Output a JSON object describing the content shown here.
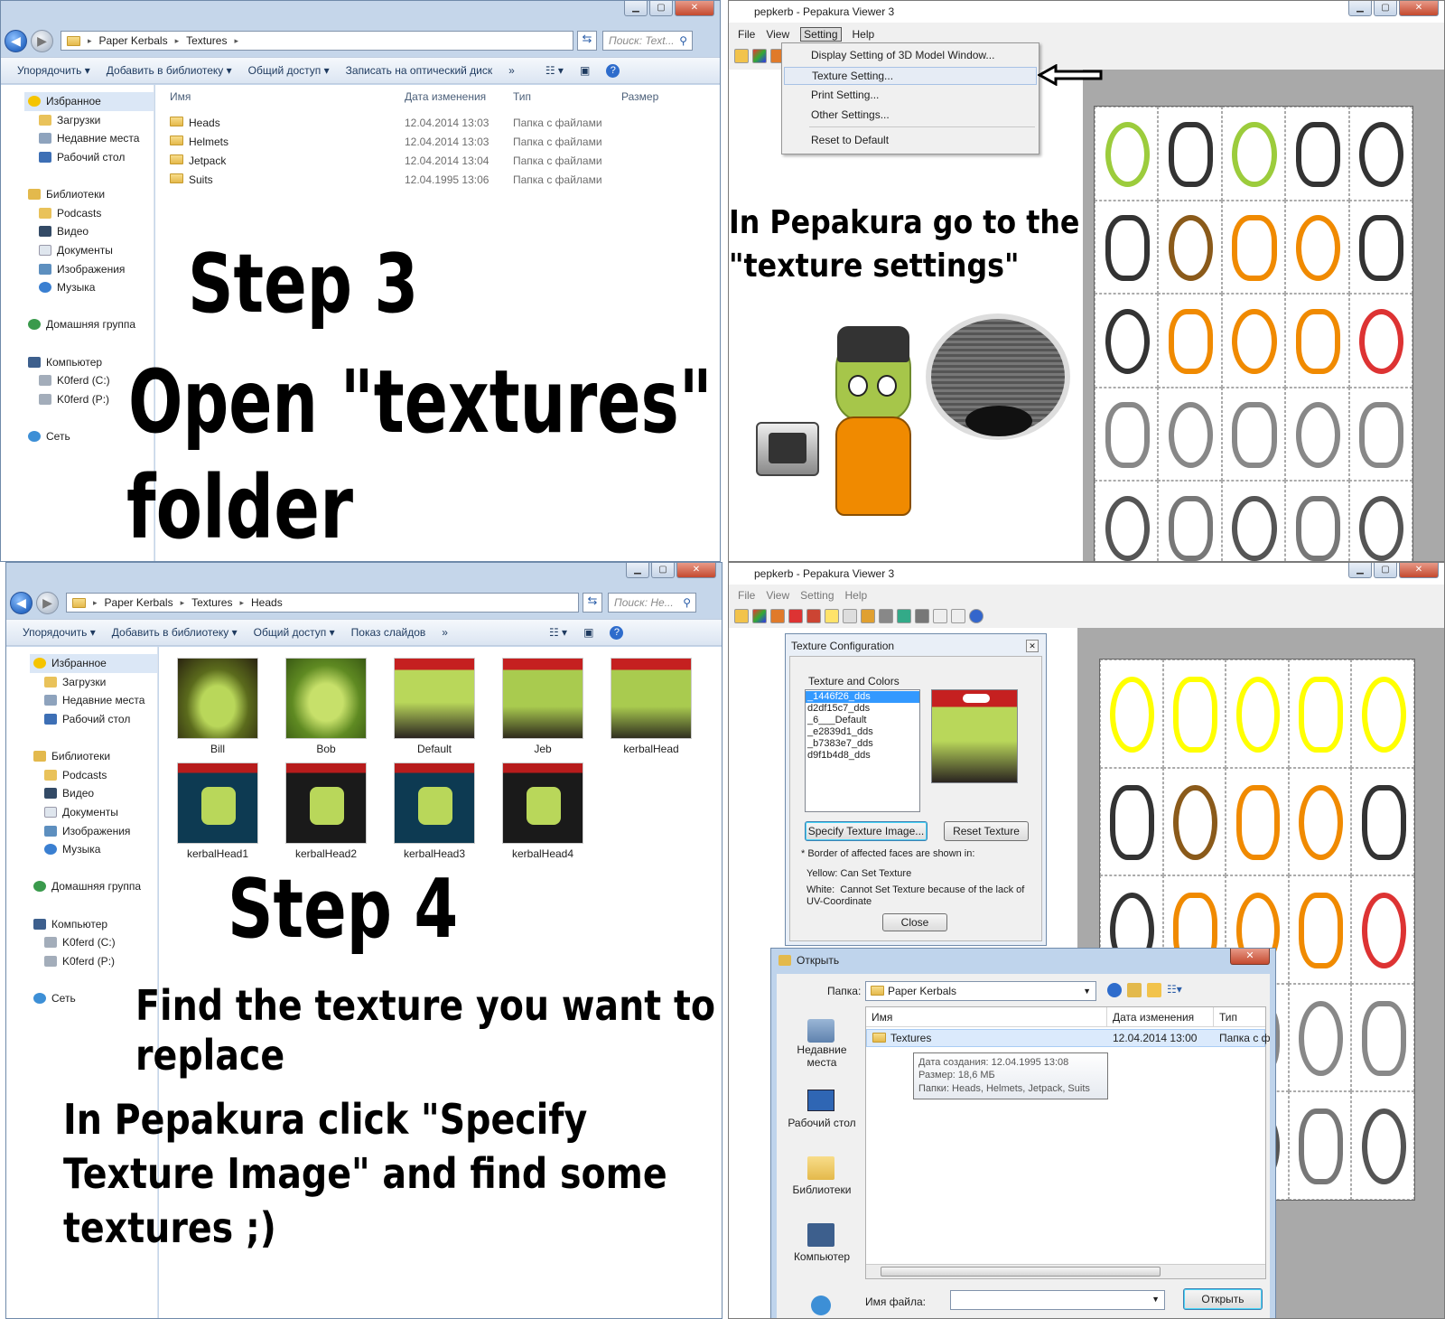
{
  "explorer1": {
    "path": [
      "Paper Kerbals",
      "Textures"
    ],
    "search_placeholder": "Поиск: Text...",
    "toolbar": [
      "Упорядочить ▾",
      "Добавить в библиотеку ▾",
      "Общий доступ ▾",
      "Записать на оптический диск",
      "»"
    ],
    "columns": [
      "Имя",
      "Дата изменения",
      "Тип",
      "Размер"
    ],
    "files": [
      {
        "name": "Heads",
        "date": "12.04.2014 13:03",
        "type": "Папка с файлами"
      },
      {
        "name": "Helmets",
        "date": "12.04.2014 13:03",
        "type": "Папка с файлами"
      },
      {
        "name": "Jetpack",
        "date": "12.04.2014 13:04",
        "type": "Папка с файлами"
      },
      {
        "name": "Suits",
        "date": "12.04.1995 13:06",
        "type": "Папка с файлами"
      }
    ]
  },
  "nav": {
    "favorites": "Избранное",
    "fav_items": [
      "Загрузки",
      "Недавние места",
      "Рабочий стол"
    ],
    "libraries": "Библиотеки",
    "lib_items": [
      "Podcasts",
      "Видео",
      "Документы",
      "Изображения",
      "Музыка"
    ],
    "homegroup": "Домашняя группа",
    "computer": "Компьютер",
    "drives": [
      "K0ferd (C:)",
      "K0ferd (P:)"
    ],
    "network": "Сеть"
  },
  "captions": {
    "step3": "Step 3",
    "open_textures": "Open \"textures\"",
    "folder": "folder",
    "pep_hint": "In Pepakura go to the\n\"texture settings\"",
    "step4": "Step 4",
    "find_texture": "Find the texture you want to\nreplace",
    "click_specify": "In Pepakura click \"Specify\nTexture Image\" and find some\ntextures ;)"
  },
  "pepakura1": {
    "title": "pepkerb - Pepakura Viewer 3",
    "menu": [
      "File",
      "View",
      "Setting",
      "Help"
    ],
    "setting_menu": [
      "Display Setting of 3D Model Window...",
      "Texture Setting...",
      "Print Setting...",
      "Other Settings...",
      "Reset to Default"
    ]
  },
  "explorer2": {
    "path": [
      "Paper Kerbals",
      "Textures",
      "Heads"
    ],
    "search_placeholder": "Поиск: He...",
    "toolbar": [
      "Упорядочить ▾",
      "Добавить в библиотеку ▾",
      "Общий доступ ▾",
      "Показ слайдов",
      "»"
    ],
    "thumbs": [
      "Bill",
      "Bob",
      "Default",
      "Jeb",
      "kerbalHead",
      "kerbalHead1",
      "kerbalHead2",
      "kerbalHead3",
      "kerbalHead4"
    ]
  },
  "pepakura2": {
    "title": "pepkerb - Pepakura Viewer 3",
    "menu": [
      "File",
      "View",
      "Setting",
      "Help"
    ]
  },
  "texture_dialog": {
    "title": "Texture Configuration",
    "group": "Texture and Colors",
    "items": [
      "_1446f26_dds",
      "d2df15c7_dds",
      "_6___Default",
      "_e2839d1_dds",
      "_b7383e7_dds",
      "d9f1b4d8_dds"
    ],
    "specify_btn": "Specify Texture Image...",
    "reset_btn": "Reset Texture",
    "note": "* Border of affected faces are shown in:",
    "yellow": "Yellow: Can Set Texture",
    "white": "White:  Cannot Set Texture because of the lack of\nUV-Coordinate",
    "close_btn": "Close"
  },
  "open_dialog": {
    "title": "Открыть",
    "folder_label": "Папка:",
    "folder_value": "Paper Kerbals",
    "places": [
      "Недавние\nместа",
      "Рабочий стол",
      "Библиотеки",
      "Компьютер"
    ],
    "columns": [
      "Имя",
      "Дата изменения",
      "Тип"
    ],
    "row": {
      "name": "Textures",
      "date": "12.04.2014 13:00",
      "type": "Папка с ф"
    },
    "tooltip": [
      "Дата создания: 12.04.1995 13:08",
      "Размер: 18,6 МБ",
      "Папки: Heads, Helmets, Jetpack, Suits"
    ],
    "filename_label": "Имя файла:",
    "open_btn": "Открыть"
  },
  "colors": {
    "accent": "#3399ff",
    "kerbal_green": "#a6c64a",
    "suit_orange": "#f08a00",
    "texture_yellow": "#ffff00"
  }
}
